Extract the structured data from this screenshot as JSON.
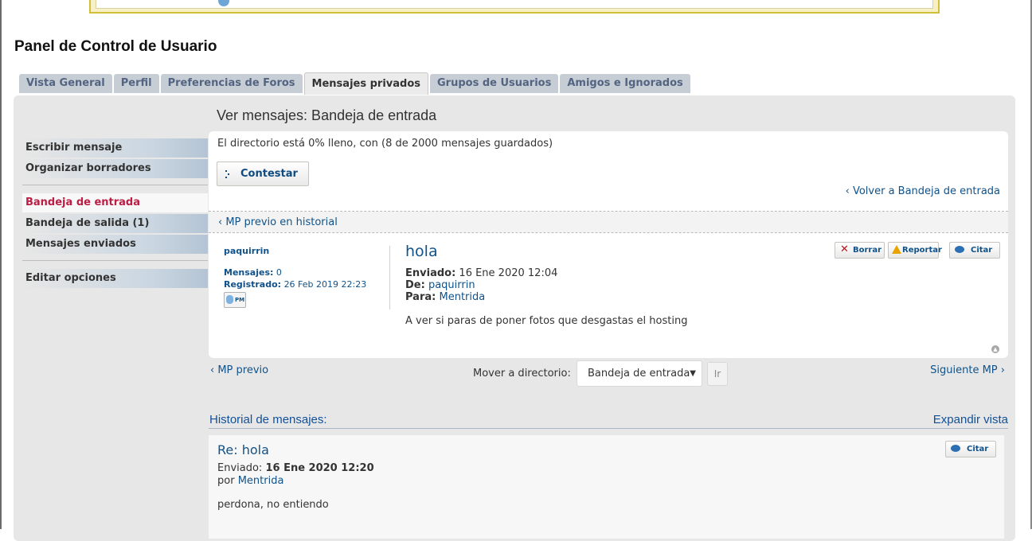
{
  "page": {
    "title": "Panel de Control de Usuario",
    "view_title": "Ver mensajes: Bandeja de entrada"
  },
  "tabs": [
    {
      "label": "Vista General"
    },
    {
      "label": "Perfil"
    },
    {
      "label": "Preferencias de Foros"
    },
    {
      "label": "Mensajes privados",
      "active": true
    },
    {
      "label": "Grupos de Usuarios"
    },
    {
      "label": "Amigos e Ignorados"
    }
  ],
  "sidebar": {
    "groups": [
      [
        "Escribir mensaje",
        "Organizar borradores"
      ],
      [
        "Bandeja de entrada",
        "Bandeja de salida (1)",
        "Mensajes enviados"
      ],
      [
        "Editar opciones"
      ]
    ],
    "active": "Bandeja de entrada"
  },
  "folder": {
    "status": "El directorio está 0% lleno, con (8 de 2000 mensajes guardados)",
    "reply_label": "Contestar",
    "back_link": "Volver a Bandeja de entrada",
    "prev_history_link": "MP previo en historial"
  },
  "message": {
    "author": "paquirrin",
    "posts_label": "Mensajes:",
    "posts_value": "0",
    "registered_label": "Registrado:",
    "registered_value": "26 Feb 2019 22:23",
    "pm_icon_text": "PM",
    "subject": "hola",
    "sent_label": "Enviado:",
    "sent_value": "16 Ene 2020 12:04",
    "from_label": "De:",
    "from_value": "paquirrin",
    "to_label": "Para:",
    "to_value": "Mentrida",
    "body": "A ver si paras de poner fotos que desgastas el hosting",
    "buttons": {
      "delete": "Borrar",
      "report": "Reportar",
      "quote": "Citar"
    }
  },
  "navigation": {
    "prev": "MP previo",
    "move_label": "Mover a directorio:",
    "move_selected": "Bandeja de entrada",
    "go_label": "Ir",
    "next": "Siguiente MP"
  },
  "history": {
    "title": "Historial de mensajes:",
    "expand": "Expandir vista",
    "items": [
      {
        "subject": "Re: hola",
        "sent_label": "Enviado:",
        "sent_value": "16 Ene 2020 12:20",
        "by_label": "por",
        "by_value": "Mentrida",
        "body": "perdona, no entiendo",
        "quote_label": "Citar"
      }
    ]
  },
  "colors": {
    "link": "#105289",
    "active_sidebar": "#bc1d45",
    "tab_bg": "#c6cdd4",
    "panel_bg": "#e7e7e7"
  }
}
